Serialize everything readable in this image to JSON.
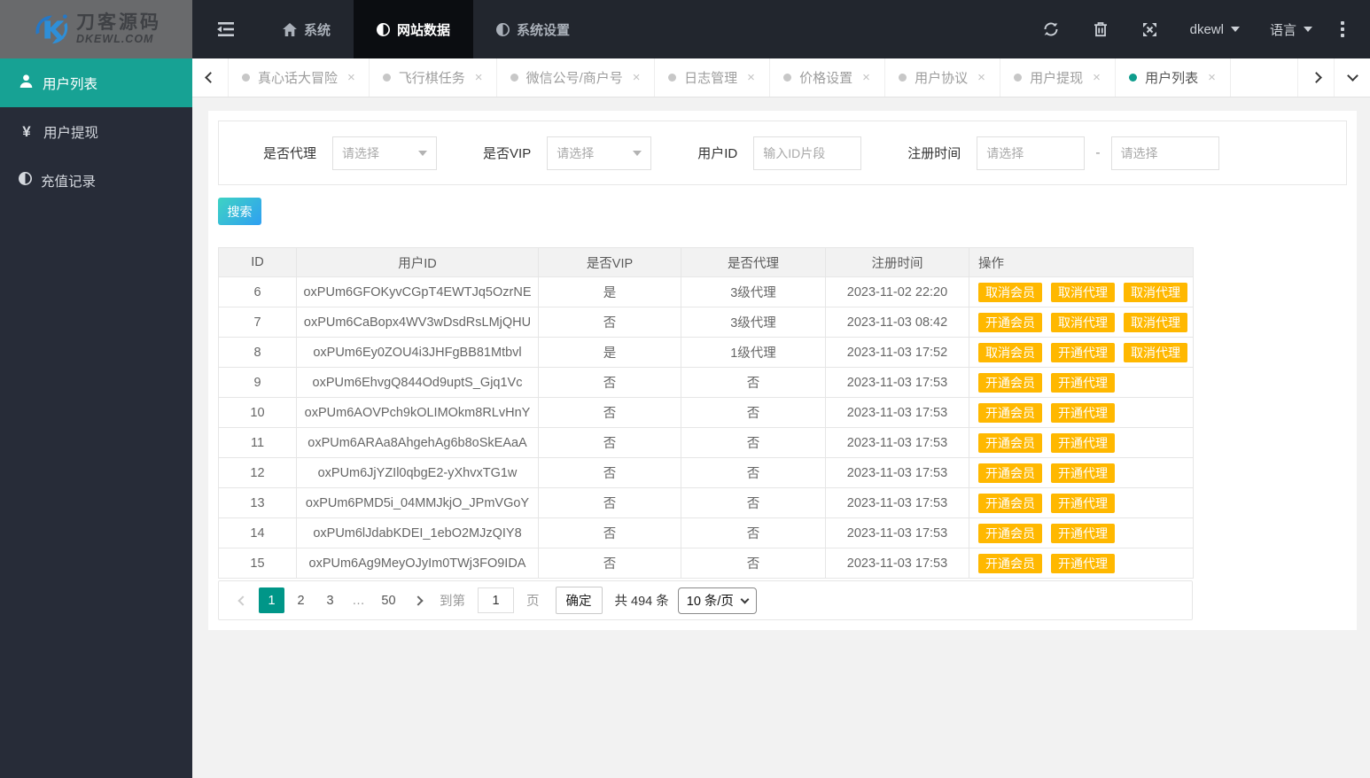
{
  "brand": {
    "title": "刀客源码",
    "subtitle": "DKEWL.COM"
  },
  "topnav": {
    "items": [
      {
        "label": "系统",
        "icon": "home-icon",
        "active": false
      },
      {
        "label": "网站数据",
        "icon": "half-circle-icon",
        "active": true
      },
      {
        "label": "系统设置",
        "icon": "half-circle-icon",
        "active": false
      }
    ],
    "user_menu": "dkewl",
    "language_menu": "语言"
  },
  "sidebar": {
    "items": [
      {
        "label": "用户列表",
        "icon": "user-icon",
        "active": true
      },
      {
        "label": "用户提现",
        "icon": "yen-icon",
        "active": false
      },
      {
        "label": "充值记录",
        "icon": "half-circle-icon",
        "active": false
      }
    ]
  },
  "tabs": [
    {
      "label": "真心话大冒险",
      "active": false
    },
    {
      "label": "飞行棋任务",
      "active": false
    },
    {
      "label": "微信公号/商户号",
      "active": false
    },
    {
      "label": "日志管理",
      "active": false
    },
    {
      "label": "价格设置",
      "active": false
    },
    {
      "label": "用户协议",
      "active": false
    },
    {
      "label": "用户提现",
      "active": false
    },
    {
      "label": "用户列表",
      "active": true
    }
  ],
  "filters": {
    "agent_label": "是否代理",
    "agent_placeholder": "请选择",
    "vip_label": "是否VIP",
    "vip_placeholder": "请选择",
    "userid_label": "用户ID",
    "userid_placeholder": "输入ID片段",
    "regtime_label": "注册时间",
    "regtime_start_placeholder": "请选择",
    "regtime_end_placeholder": "请选择",
    "range_separator": "-"
  },
  "search_label": "搜索",
  "table": {
    "headers": [
      "ID",
      "用户ID",
      "是否VIP",
      "是否代理",
      "注册时间",
      "操作"
    ],
    "rows": [
      {
        "id": "6",
        "user_id": "oxPUm6GFOKyvCGpT4EWTJq5OzrNE",
        "vip": "是",
        "vip_red": false,
        "agent": "3级代理",
        "agent_red": false,
        "time": "2023-11-02 22:20",
        "actions": [
          "取消会员",
          "取消代理",
          "取消代理"
        ]
      },
      {
        "id": "7",
        "user_id": "oxPUm6CaBopx4WV3wDsdRsLMjQHU",
        "vip": "否",
        "vip_red": true,
        "agent": "3级代理",
        "agent_red": false,
        "time": "2023-11-03 08:42",
        "actions": [
          "开通会员",
          "取消代理",
          "取消代理"
        ]
      },
      {
        "id": "8",
        "user_id": "oxPUm6Ey0ZOU4i3JHFgBB81Mtbvl",
        "vip": "是",
        "vip_red": false,
        "agent": "1级代理",
        "agent_red": false,
        "time": "2023-11-03 17:52",
        "actions": [
          "取消会员",
          "开通代理",
          "取消代理"
        ]
      },
      {
        "id": "9",
        "user_id": "oxPUm6EhvgQ844Od9uptS_Gjq1Vc",
        "vip": "否",
        "vip_red": true,
        "agent": "否",
        "agent_red": true,
        "time": "2023-11-03 17:53",
        "actions": [
          "开通会员",
          "开通代理"
        ]
      },
      {
        "id": "10",
        "user_id": "oxPUm6AOVPch9kOLIMOkm8RLvHnY",
        "vip": "否",
        "vip_red": true,
        "agent": "否",
        "agent_red": true,
        "time": "2023-11-03 17:53",
        "actions": [
          "开通会员",
          "开通代理"
        ]
      },
      {
        "id": "11",
        "user_id": "oxPUm6ARAa8AhgehAg6b8oSkEAaA",
        "vip": "否",
        "vip_red": true,
        "agent": "否",
        "agent_red": true,
        "time": "2023-11-03 17:53",
        "actions": [
          "开通会员",
          "开通代理"
        ]
      },
      {
        "id": "12",
        "user_id": "oxPUm6JjYZIl0qbgE2-yXhvxTG1w",
        "vip": "否",
        "vip_red": true,
        "agent": "否",
        "agent_red": true,
        "time": "2023-11-03 17:53",
        "actions": [
          "开通会员",
          "开通代理"
        ]
      },
      {
        "id": "13",
        "user_id": "oxPUm6PMD5i_04MMJkjO_JPmVGoY",
        "vip": "否",
        "vip_red": true,
        "agent": "否",
        "agent_red": true,
        "time": "2023-11-03 17:53",
        "actions": [
          "开通会员",
          "开通代理"
        ]
      },
      {
        "id": "14",
        "user_id": "oxPUm6lJdabKDEI_1ebO2MJzQIY8",
        "vip": "否",
        "vip_red": true,
        "agent": "否",
        "agent_red": true,
        "time": "2023-11-03 17:53",
        "actions": [
          "开通会员",
          "开通代理"
        ]
      },
      {
        "id": "15",
        "user_id": "oxPUm6Ag9MeyOJyIm0TWj3FO9IDA",
        "vip": "否",
        "vip_red": true,
        "agent": "否",
        "agent_red": true,
        "time": "2023-11-03 17:53",
        "actions": [
          "开通会员",
          "开通代理"
        ]
      }
    ]
  },
  "pagination": {
    "pages": [
      "1",
      "2",
      "3",
      "…",
      "50"
    ],
    "active_page": "1",
    "goto_label": "到第",
    "goto_value": "1",
    "page_unit_label": "页",
    "confirm_label": "确定",
    "total_label": "共 494 条",
    "page_size": "10 条/页"
  },
  "colors": {
    "accent_teal": "#17a294",
    "pagination_active": "#009688",
    "warn_button": "#ffb800",
    "danger_text": "#f4170b",
    "header_bg": "#22262e",
    "sidebar_bg": "#272c38"
  }
}
